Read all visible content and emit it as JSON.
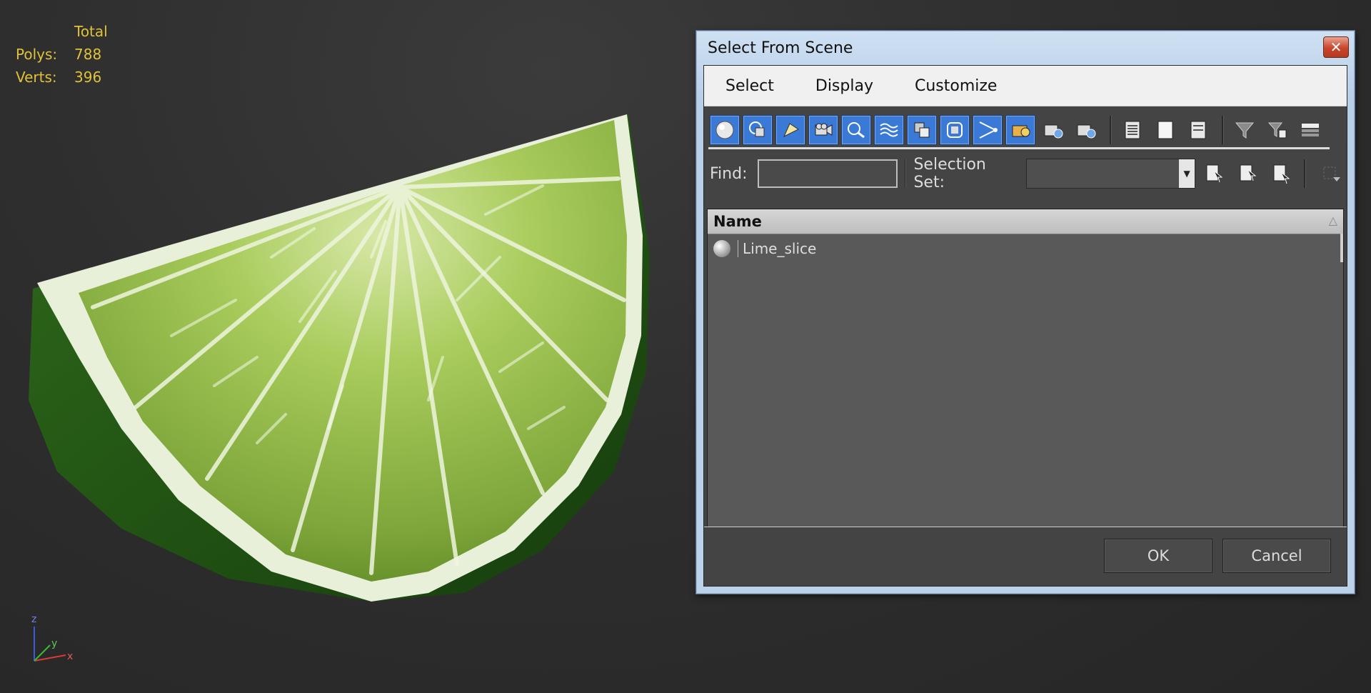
{
  "viewport": {
    "stats": {
      "header": "Total",
      "rows": [
        {
          "label": "Polys:",
          "value": "788"
        },
        {
          "label": "Verts:",
          "value": "396"
        }
      ]
    },
    "axis": {
      "z": "z",
      "y": "y",
      "x": "x"
    },
    "stats_color": "#e0c23a"
  },
  "dialog": {
    "title": "Select From Scene",
    "close_label": "✕",
    "menus": [
      "Select",
      "Display",
      "Customize"
    ],
    "toolbar": {
      "filter_icons": [
        "geometry-icon",
        "shapes-icon",
        "lights-icon",
        "cameras-icon",
        "helpers-icon",
        "space-warps-icon",
        "groups-icon",
        "xrefs-icon",
        "bones-icon",
        "containers-icon",
        "frozen-icon",
        "hidden-icon"
      ],
      "accent": "#3a7ad6"
    },
    "find": {
      "label": "Find:",
      "value": ""
    },
    "selection_set": {
      "label": "Selection Set:",
      "value": ""
    },
    "list": {
      "column": "Name",
      "rows": [
        {
          "icon": "sphere-icon",
          "name": "Lime_slice"
        }
      ]
    },
    "buttons": {
      "ok": "OK",
      "cancel": "Cancel"
    }
  }
}
